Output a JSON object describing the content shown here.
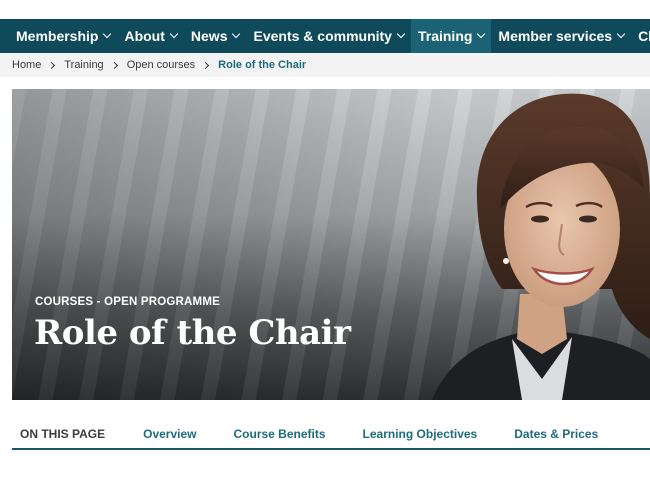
{
  "nav": {
    "items": [
      {
        "label": "Membership",
        "has_dropdown": true,
        "active": false
      },
      {
        "label": "About",
        "has_dropdown": true,
        "active": false
      },
      {
        "label": "News",
        "has_dropdown": true,
        "active": false
      },
      {
        "label": "Events & community",
        "has_dropdown": true,
        "active": false
      },
      {
        "label": "Training",
        "has_dropdown": true,
        "active": true
      },
      {
        "label": "Member services",
        "has_dropdown": true,
        "active": false
      },
      {
        "label": "Cha",
        "has_dropdown": false,
        "active": false
      }
    ]
  },
  "breadcrumb": {
    "items": [
      "Home",
      "Training",
      "Open courses"
    ],
    "current": "Role of the Chair"
  },
  "hero": {
    "eyebrow": "COURSES - OPEN PROGRAMME",
    "title": "Role of the Chair"
  },
  "page_nav": {
    "label": "ON THIS PAGE",
    "links": [
      "Overview",
      "Course Benefits",
      "Learning Objectives",
      "Dates & Prices"
    ]
  },
  "colors": {
    "nav_bg": "#0f4a5a",
    "nav_active_bg": "#1c6275",
    "accent": "#1d6b7c"
  }
}
